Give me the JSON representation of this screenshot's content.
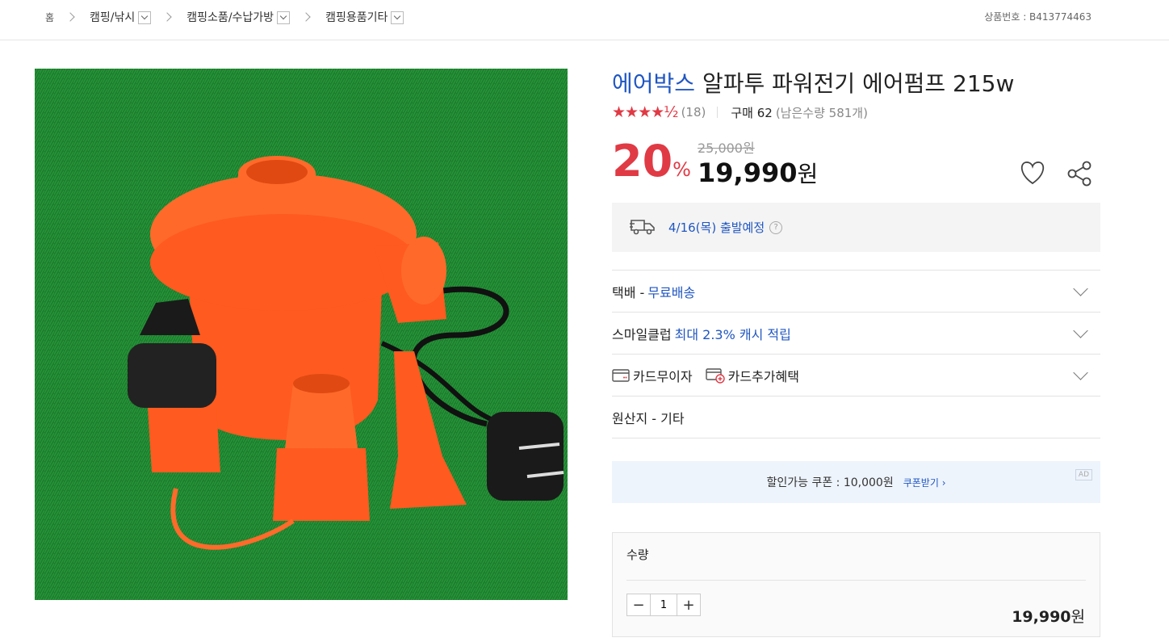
{
  "breadcrumb": {
    "home": "홈",
    "items": [
      "캠핑/낚시",
      "캠핑소품/수납가방",
      "캠핑용품기타"
    ]
  },
  "product_number": "상품번호 : B413774463",
  "product": {
    "brand": "에어박스",
    "name": " 알파투 파워전기 에어펌프 215w",
    "stars": "★★★★½",
    "rating_value": 4.5,
    "review_count": "(18)",
    "purchase_label": "구매 62",
    "stock": "(남은수량 581개)",
    "discount": "20",
    "discount_unit": "%",
    "original_price": "25,000원",
    "sale_price": "19,990",
    "currency": "원"
  },
  "shipping": {
    "date": "4/16(목) 출발예정",
    "help": "?"
  },
  "rows": {
    "delivery_label": "택배 - ",
    "delivery_value": "무료배송",
    "smile_label": "스마일클럽 ",
    "smile_value": "최대 2.3% 캐시 적립",
    "card1": "카드무이자",
    "card2": "카드추가혜택",
    "origin": "원산지 - 기타"
  },
  "coupon": {
    "text": "할인가능 쿠폰 : 10,000원",
    "get": "쿠폰받기 ›",
    "ad": "AD"
  },
  "quantity": {
    "label": "수량",
    "minus": "−",
    "value": "1",
    "plus": "+",
    "total": "19,990",
    "total_unit": "원"
  },
  "colors": {
    "accent_red": "#e03a45",
    "link_blue": "#1f56c2"
  }
}
